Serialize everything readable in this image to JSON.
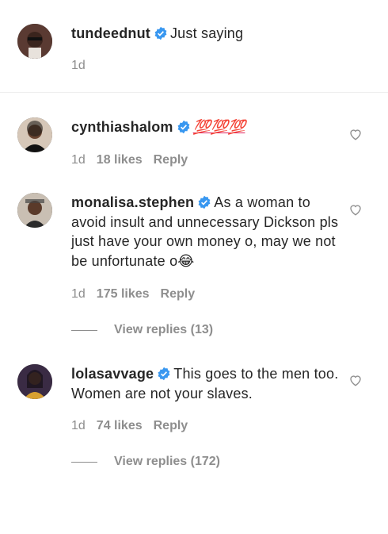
{
  "comments": [
    {
      "username": "tundeednut",
      "text": "Just saying",
      "time": "1d",
      "avatar_icon": "avatar-tundeednut"
    },
    {
      "username": "cynthiashalom",
      "text": "💯💯💯",
      "time": "1d",
      "likes": "18 likes",
      "reply": "Reply",
      "avatar_icon": "avatar-cynthiashalom"
    },
    {
      "username": "monalisa.stephen",
      "text": "As a woman to avoid insult and unnecessary Dickson pls just have your own money o, may we not be unfortunate o😂",
      "time": "1d",
      "likes": "175 likes",
      "reply": "Reply",
      "view_replies": "View replies (13)",
      "avatar_icon": "avatar-monalisa"
    },
    {
      "username": "lolasavvage",
      "text": "This goes to the men too. Women are not your slaves.",
      "time": "1d",
      "likes": "74 likes",
      "reply": "Reply",
      "view_replies": "View replies (172)",
      "avatar_icon": "avatar-lolasavvage"
    }
  ],
  "colors": {
    "text": "#262626",
    "muted": "#8e8e8e",
    "verified": "#3897f0",
    "divider": "#efefef"
  },
  "icons": [
    "verified-badge-icon",
    "heart-outline-icon",
    "laughing-emoji-icon"
  ]
}
